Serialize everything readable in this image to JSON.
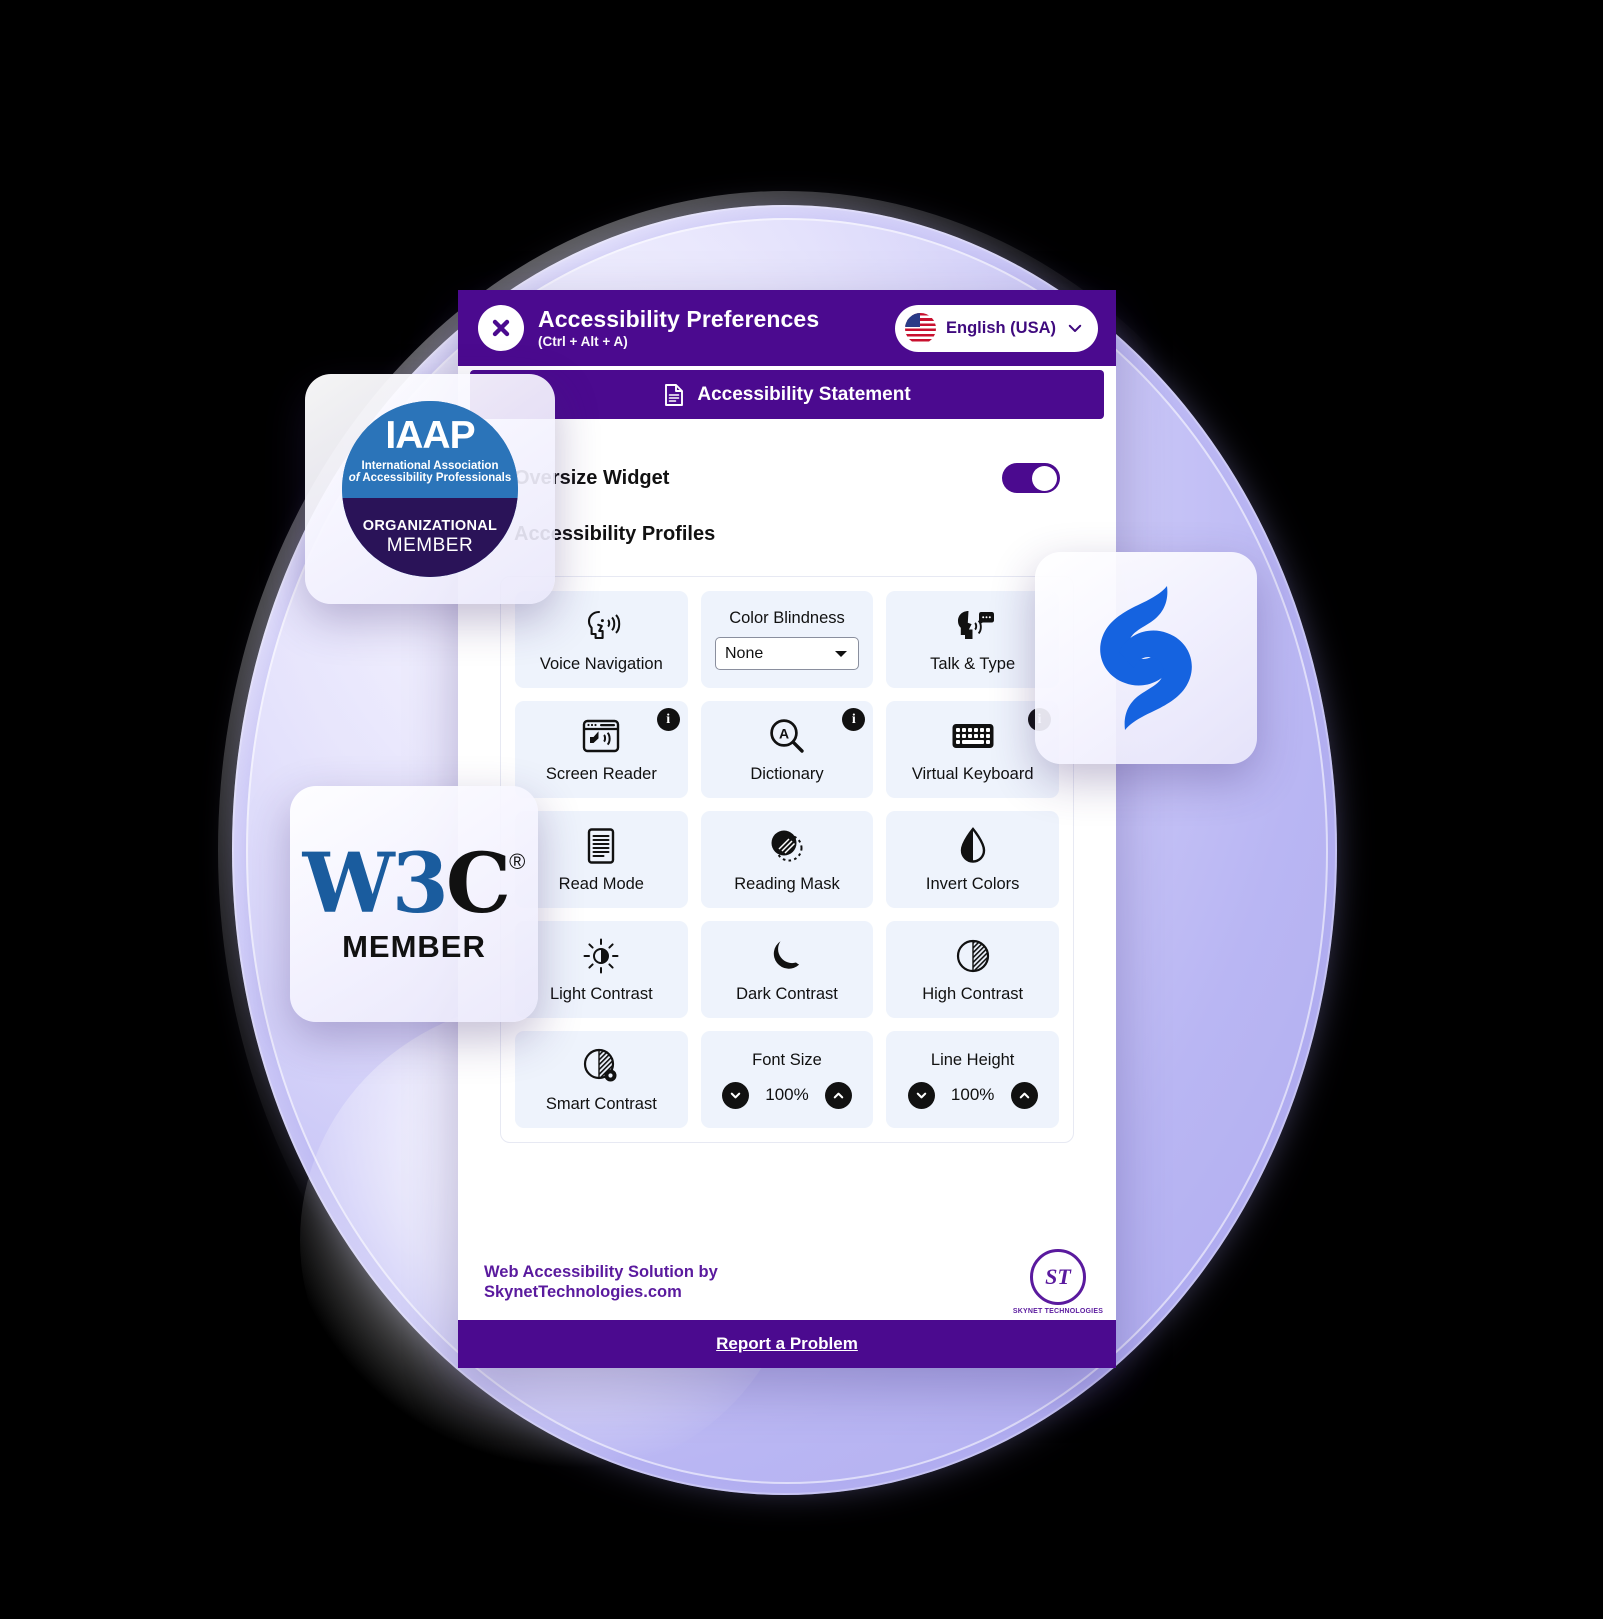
{
  "widget": {
    "header": {
      "title": "Accessibility Preferences",
      "shortcut": "(Ctrl + Alt + A)",
      "close_icon": "close-x-icon",
      "language": {
        "label": "English (USA)",
        "flag_icon": "usa-flag-icon",
        "chevron_icon": "chevron-down-icon"
      }
    },
    "statement_button": {
      "label": "Accessibility Statement",
      "icon": "document-icon"
    },
    "oversize_widget": {
      "label": "Oversize Widget",
      "state": "on"
    },
    "profiles_label": "Accessibility Profiles",
    "tiles": [
      {
        "label": "Voice Navigation",
        "icon": "voice-navigation-icon",
        "type": "icon",
        "info": false
      },
      {
        "label": "Color Blindness",
        "icon": "color-blindness-select",
        "type": "select",
        "value": "None",
        "info": false
      },
      {
        "label": "Talk & Type",
        "icon": "talk-and-type-icon",
        "type": "icon",
        "info": false
      },
      {
        "label": "Screen Reader",
        "icon": "screen-reader-icon",
        "type": "icon",
        "info": true
      },
      {
        "label": "Dictionary",
        "icon": "dictionary-icon",
        "type": "icon",
        "info": true
      },
      {
        "label": "Virtual Keyboard",
        "icon": "virtual-keyboard-icon",
        "type": "icon",
        "info": true
      },
      {
        "label": "Read Mode",
        "icon": "read-mode-icon",
        "type": "icon",
        "info": false
      },
      {
        "label": "Reading Mask",
        "icon": "reading-mask-icon",
        "type": "icon",
        "info": false
      },
      {
        "label": "Invert Colors",
        "icon": "invert-colors-icon",
        "type": "icon",
        "info": false
      },
      {
        "label": "Light Contrast",
        "icon": "light-contrast-icon",
        "type": "icon",
        "info": false
      },
      {
        "label": "Dark Contrast",
        "icon": "dark-contrast-icon",
        "type": "icon",
        "info": false
      },
      {
        "label": "High Contrast",
        "icon": "high-contrast-icon",
        "type": "icon",
        "info": false
      },
      {
        "label": "Smart Contrast",
        "icon": "smart-contrast-icon",
        "type": "icon",
        "info": false
      },
      {
        "label": "Font Size",
        "icon": "font-size-stepper",
        "type": "stepper",
        "value": "100%"
      },
      {
        "label": "Line Height",
        "icon": "line-height-stepper",
        "type": "stepper",
        "value": "100%"
      }
    ],
    "info_badge_glyph": "i",
    "stepper": {
      "decrease_icon": "chevron-down-icon",
      "increase_icon": "chevron-up-icon"
    },
    "footer": {
      "credit_line1": "Web Accessibility Solution by",
      "credit_line2": "SkynetTechnologies.com",
      "logo": {
        "mark": "ST",
        "name": "SKYNET TECHNOLOGIES"
      },
      "report_link": "Report a Problem"
    }
  },
  "badges": {
    "iaap": {
      "acronym": "IAAP",
      "line1": "International Association",
      "line2_italic": "of",
      "line2": " Accessibility Professionals",
      "org": "ORGANIZATIONAL",
      "member": "MEMBER"
    },
    "w3c": {
      "mark_blue": "W3",
      "mark_black": "C",
      "registered": "®",
      "member": "MEMBER"
    },
    "blue_logo": {
      "icon": "skynet-s-mark-icon"
    }
  },
  "colors": {
    "brand_purple": "#4b0a8f",
    "tile_blue": "#eef3fc",
    "iaap_blue": "#2b74b9",
    "iaap_navy": "#2a1358",
    "w3c_blue": "#1a5c9e",
    "logo_blue": "#1563e0",
    "blob_purple": "#b9b6f3"
  }
}
